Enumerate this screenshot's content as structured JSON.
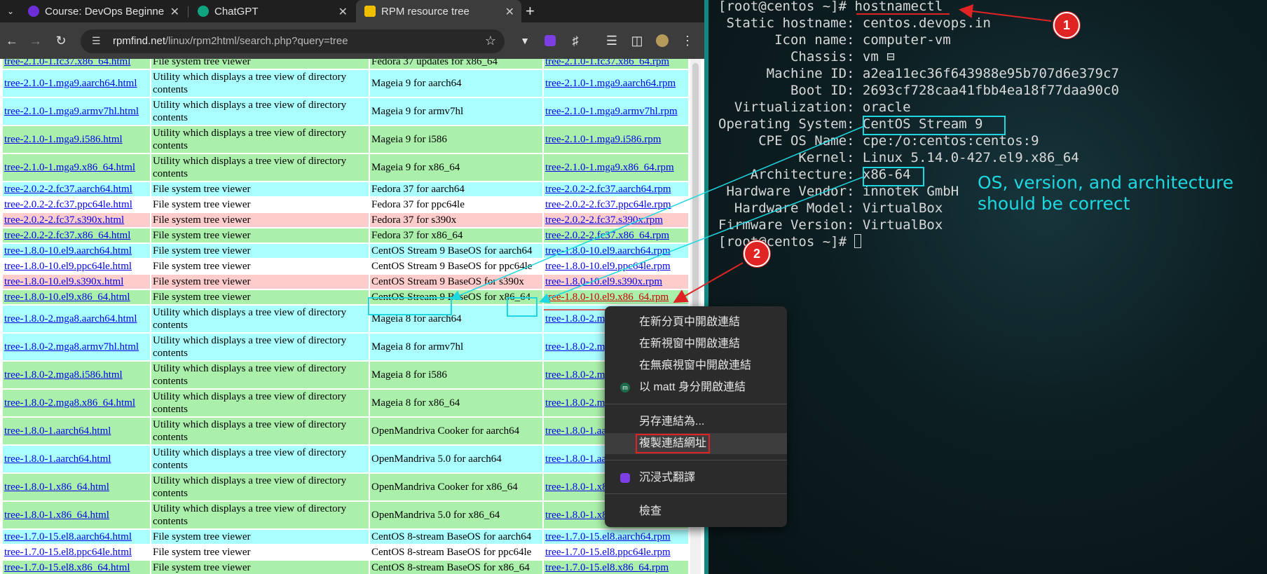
{
  "browser": {
    "tabs": [
      {
        "title": "Course: DevOps Beginne",
        "favicon_color": "#6b2fd6"
      },
      {
        "title": "ChatGPT",
        "favicon_color": "#10a37f"
      },
      {
        "title": "RPM resource tree",
        "favicon_color": "#f0c000"
      }
    ],
    "new_tab_label": "+",
    "url_host": "rpmfind.net",
    "url_path": "/linux/rpm2html/search.php?query=tree"
  },
  "table": {
    "rows": [
      {
        "name": "tree-2.1.0-1.fc37.x86_64.html",
        "summary": "File system tree viewer",
        "dist": "Fedora 37 updates for x86_64",
        "rpm": "tree-2.1.0-1.fc37.x86_64.rpm",
        "color": "green"
      },
      {
        "name": "tree-2.1.0-1.mga9.aarch64.html",
        "summary": "Utility which displays a tree view of directory contents",
        "dist": "Mageia 9 for aarch64",
        "rpm": "tree-2.1.0-1.mga9.aarch64.rpm",
        "color": "cyan"
      },
      {
        "name": "tree-2.1.0-1.mga9.armv7hl.html",
        "summary": "Utility which displays a tree view of directory contents",
        "dist": "Mageia 9 for armv7hl",
        "rpm": "tree-2.1.0-1.mga9.armv7hl.rpm",
        "color": "cyan"
      },
      {
        "name": "tree-2.1.0-1.mga9.i586.html",
        "summary": "Utility which displays a tree view of directory contents",
        "dist": "Mageia 9 for i586",
        "rpm": "tree-2.1.0-1.mga9.i586.rpm",
        "color": "green"
      },
      {
        "name": "tree-2.1.0-1.mga9.x86_64.html",
        "summary": "Utility which displays a tree view of directory contents",
        "dist": "Mageia 9 for x86_64",
        "rpm": "tree-2.1.0-1.mga9.x86_64.rpm",
        "color": "green"
      },
      {
        "name": "tree-2.0.2-2.fc37.aarch64.html",
        "summary": "File system tree viewer",
        "dist": "Fedora 37 for aarch64",
        "rpm": "tree-2.0.2-2.fc37.aarch64.rpm",
        "color": "cyan"
      },
      {
        "name": "tree-2.0.2-2.fc37.ppc64le.html",
        "summary": "File system tree viewer",
        "dist": "Fedora 37 for ppc64le",
        "rpm": "tree-2.0.2-2.fc37.ppc64le.rpm",
        "color": "white"
      },
      {
        "name": "tree-2.0.2-2.fc37.s390x.html",
        "summary": "File system tree viewer",
        "dist": "Fedora 37 for s390x",
        "rpm": "tree-2.0.2-2.fc37.s390x.rpm",
        "color": "pink"
      },
      {
        "name": "tree-2.0.2-2.fc37.x86_64.html",
        "summary": "File system tree viewer",
        "dist": "Fedora 37 for x86_64",
        "rpm": "tree-2.0.2-2.fc37.x86_64.rpm",
        "color": "green"
      },
      {
        "name": "tree-1.8.0-10.el9.aarch64.html",
        "summary": "File system tree viewer",
        "dist": "CentOS Stream 9 BaseOS for aarch64",
        "rpm": "tree-1.8.0-10.el9.aarch64.rpm",
        "color": "cyan"
      },
      {
        "name": "tree-1.8.0-10.el9.ppc64le.html",
        "summary": "File system tree viewer",
        "dist": "CentOS Stream 9 BaseOS for ppc64le",
        "rpm": "tree-1.8.0-10.el9.ppc64le.rpm",
        "color": "white"
      },
      {
        "name": "tree-1.8.0-10.el9.s390x.html",
        "summary": "File system tree viewer",
        "dist": "CentOS Stream 9 BaseOS for s390x",
        "rpm": "tree-1.8.0-10.el9.s390x.rpm",
        "color": "pink"
      },
      {
        "name": "tree-1.8.0-10.el9.x86_64.html",
        "summary": "File system tree viewer",
        "dist": "CentOS Stream 9 BaseOS for x86_64",
        "rpm": "tree-1.8.0-10.el9.x86_64.rpm",
        "color": "green"
      },
      {
        "name": "tree-1.8.0-2.mga8.aarch64.html",
        "summary": "Utility which displays a tree view of directory contents",
        "dist": "Mageia 8 for aarch64",
        "rpm": "tree-1.8.0-2.mga8.aarch64.rpm",
        "color": "cyan"
      },
      {
        "name": "tree-1.8.0-2.mga8.armv7hl.html",
        "summary": "Utility which displays a tree view of directory contents",
        "dist": "Mageia 8 for armv7hl",
        "rpm": "tree-1.8.0-2.mga8.armv7hl.rpm",
        "color": "cyan"
      },
      {
        "name": "tree-1.8.0-2.mga8.i586.html",
        "summary": "Utility which displays a tree view of directory contents",
        "dist": "Mageia 8 for i586",
        "rpm": "tree-1.8.0-2.mga8.i586.rpm",
        "color": "green"
      },
      {
        "name": "tree-1.8.0-2.mga8.x86_64.html",
        "summary": "Utility which displays a tree view of directory contents",
        "dist": "Mageia 8 for x86_64",
        "rpm": "tree-1.8.0-2.mga8.x86_64.rpm",
        "color": "green"
      },
      {
        "name": "tree-1.8.0-1.aarch64.html",
        "summary": "Utility which displays a tree view of directory contents",
        "dist": "OpenMandriva Cooker for aarch64",
        "rpm": "tree-1.8.0-1.aarch64.rpm",
        "color": "green"
      },
      {
        "name": "tree-1.8.0-1.aarch64.html",
        "summary": "Utility which displays a tree view of directory contents",
        "dist": "OpenMandriva 5.0 for aarch64",
        "rpm": "tree-1.8.0-1.aarch64.rpm",
        "color": "cyan"
      },
      {
        "name": "tree-1.8.0-1.x86_64.html",
        "summary": "Utility which displays a tree view of directory contents",
        "dist": "OpenMandriva Cooker for x86_64",
        "rpm": "tree-1.8.0-1.x86_64.rpm",
        "color": "green"
      },
      {
        "name": "tree-1.8.0-1.x86_64.html",
        "summary": "Utility which displays a tree view of directory contents",
        "dist": "OpenMandriva 5.0 for x86_64",
        "rpm": "tree-1.8.0-1.x86_64.rpm",
        "color": "green"
      },
      {
        "name": "tree-1.7.0-15.el8.aarch64.html",
        "summary": "File system tree viewer",
        "dist": "CentOS 8-stream BaseOS for aarch64",
        "rpm": "tree-1.7.0-15.el8.aarch64.rpm",
        "color": "cyan"
      },
      {
        "name": "tree-1.7.0-15.el8.ppc64le.html",
        "summary": "File system tree viewer",
        "dist": "CentOS 8-stream BaseOS for ppc64le",
        "rpm": "tree-1.7.0-15.el8.ppc64le.rpm",
        "color": "white"
      },
      {
        "name": "tree-1.7.0-15.el8.x86_64.html",
        "summary": "File system tree viewer",
        "dist": "CentOS 8-stream BaseOS for x86_64",
        "rpm": "tree-1.7.0-15.el8.x86_64.rpm",
        "color": "green"
      }
    ]
  },
  "context_menu": {
    "items": [
      {
        "label": "在新分頁中開啟連結",
        "icon": ""
      },
      {
        "label": "在新視窗中開啟連結",
        "icon": ""
      },
      {
        "label": "在無痕視窗中開啟連結",
        "icon": ""
      },
      {
        "label": "以 matt 身分開啟連結",
        "icon": "avatar",
        "icon_text": "m"
      },
      {
        "label": "另存連結為...",
        "icon": ""
      },
      {
        "label": "複製連結網址",
        "icon": "",
        "selected": true
      },
      {
        "label": "沉浸式翻譯",
        "icon": "translate"
      },
      {
        "label": "檢查",
        "icon": ""
      }
    ]
  },
  "terminal": {
    "lines": [
      "[root@centos ~]# hostnamectl",
      " Static hostname: centos.devops.in",
      "       Icon name: computer-vm",
      "         Chassis: vm ⊟",
      "      Machine ID: a2ea11ec36f643988e95b707d6e379c7",
      "         Boot ID: 2693cf728caa41fbb4ea18f77daa90c0",
      "  Virtualization: oracle",
      "Operating System: CentOS Stream 9",
      "     CPE OS Name: cpe:/o:centos:centos:9",
      "          Kernel: Linux 5.14.0-427.el9.x86_64",
      "    Architecture: x86-64",
      " Hardware Vendor: innotek GmbH",
      "  Hardware Model: VirtualBox",
      "Firmware Version: VirtualBox",
      "[root@centos ~]# "
    ]
  },
  "annotations": {
    "note": "OS, version, and architecture\nshould be correct",
    "badge1": "1",
    "badge2": "2",
    "highlight_color": "#1ed7e0",
    "arrow_color": "#e02424"
  }
}
